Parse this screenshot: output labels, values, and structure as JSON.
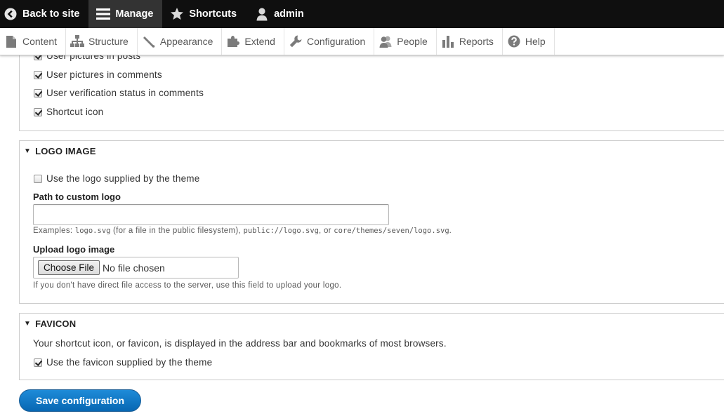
{
  "toolbar": {
    "back": {
      "label": "Back to site",
      "icon": "chevron-left-circle-icon"
    },
    "manage": {
      "label": "Manage",
      "icon": "hamburger-icon"
    },
    "shortcuts": {
      "label": "Shortcuts",
      "icon": "star-icon"
    },
    "user": {
      "label": "admin",
      "icon": "user-icon"
    }
  },
  "tray": {
    "items": [
      {
        "label": "Content",
        "icon": "document-icon"
      },
      {
        "label": "Structure",
        "icon": "sitemap-icon"
      },
      {
        "label": "Appearance",
        "icon": "paint-brush-icon"
      },
      {
        "label": "Extend",
        "icon": "puzzle-icon"
      },
      {
        "label": "Configuration",
        "icon": "wrench-icon"
      },
      {
        "label": "People",
        "icon": "people-icon"
      },
      {
        "label": "Reports",
        "icon": "bar-chart-icon"
      },
      {
        "label": "Help",
        "icon": "question-icon"
      }
    ]
  },
  "toggles": {
    "items": [
      {
        "label": "User pictures in posts",
        "checked": true
      },
      {
        "label": "User pictures in comments",
        "checked": true
      },
      {
        "label": "User verification status in comments",
        "checked": true
      },
      {
        "label": "Shortcut icon",
        "checked": true
      }
    ]
  },
  "logo": {
    "legend": "LOGO IMAGE",
    "use_default_label": "Use the logo supplied by the theme",
    "use_default_checked": false,
    "path_label": "Path to custom logo",
    "path_value": "",
    "examples_prefix": "Examples: ",
    "examples_code1": "logo.svg",
    "examples_mid1": " (for a file in the public filesystem), ",
    "examples_code2": "public://logo.svg",
    "examples_mid2": ", or ",
    "examples_code3": "core/themes/seven/logo.svg",
    "examples_suffix": ".",
    "upload_label": "Upload logo image",
    "choose_file_label": "Choose File",
    "no_file_text": "No file chosen",
    "upload_desc": "If you don't have direct file access to the server, use this field to upload your logo."
  },
  "favicon": {
    "legend": "FAVICON",
    "description": "Your shortcut icon, or favicon, is displayed in the address bar and bookmarks of most browsers.",
    "use_default_label": "Use the favicon supplied by the theme",
    "use_default_checked": true
  },
  "actions": {
    "save_label": "Save configuration"
  },
  "colors": {
    "toolbar_bg": "#0f0f0f",
    "primary_button": "#0767b3"
  }
}
